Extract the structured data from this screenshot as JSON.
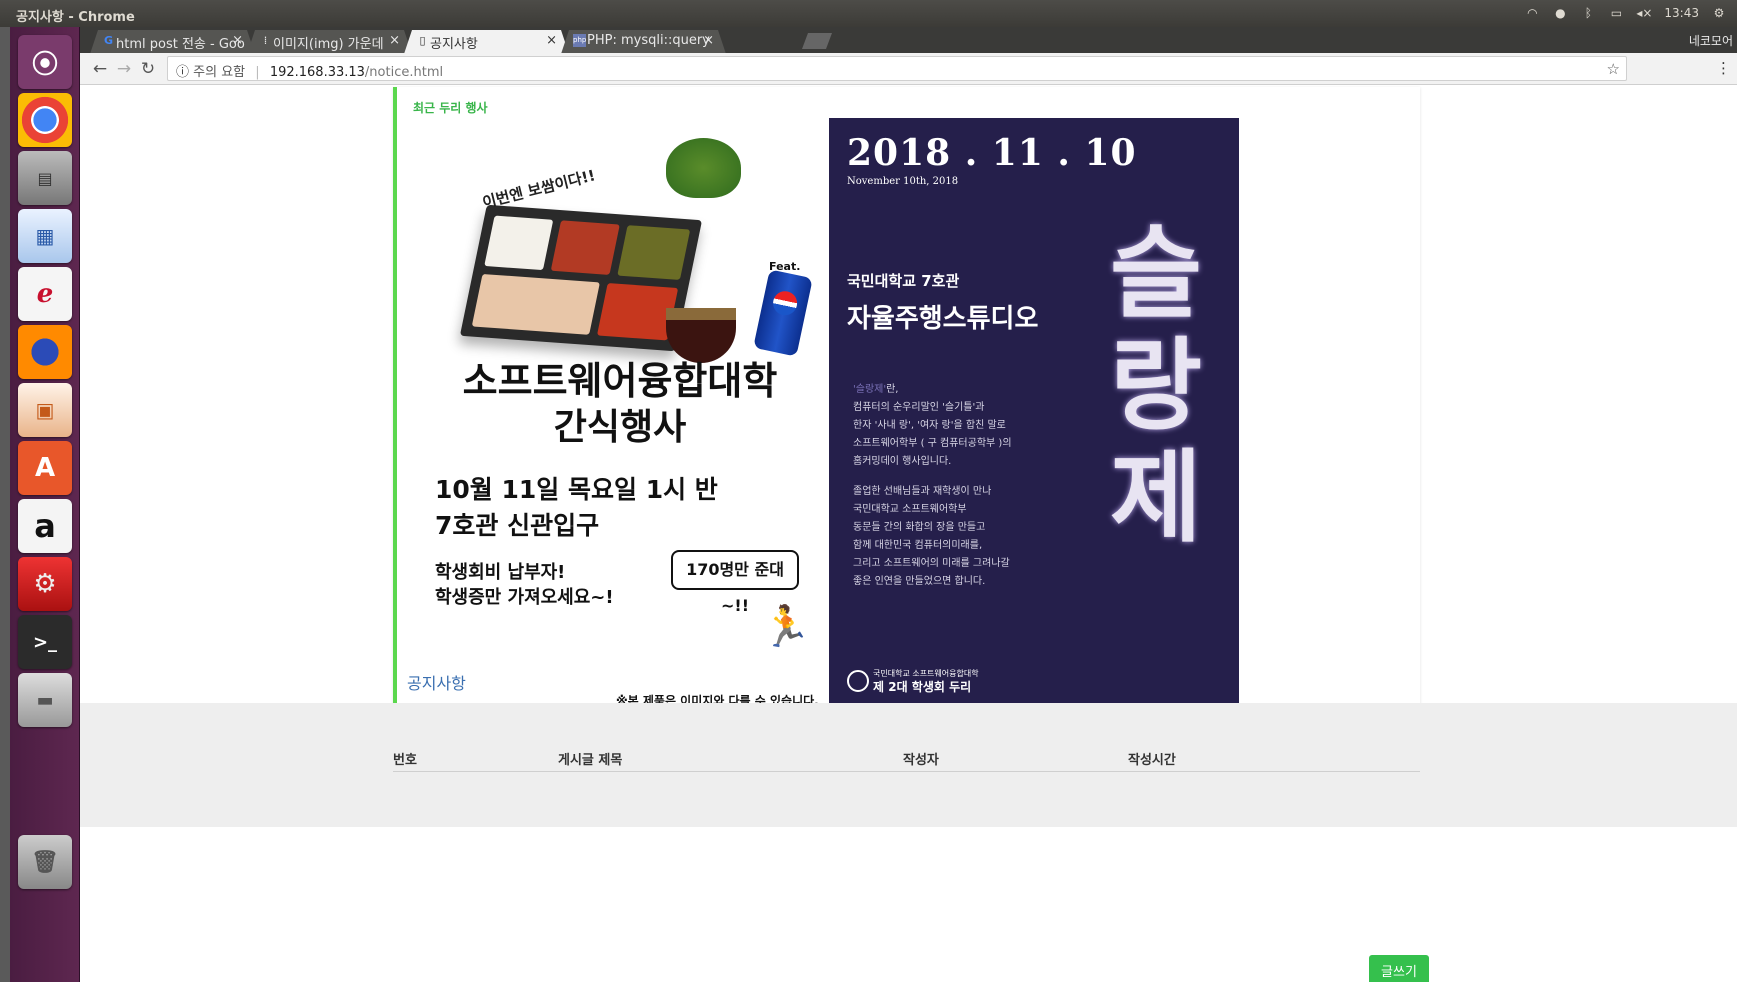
{
  "os": {
    "window_title": "공지사항 - Chrome",
    "clock": "13:43"
  },
  "browser": {
    "tabs": [
      {
        "label": "html post 전송 - Goo",
        "icon": "google-icon"
      },
      {
        "label": "이미지(img) 가운데",
        "icon": "image-tab-icon"
      },
      {
        "label": "공지사항",
        "icon": "page-icon"
      },
      {
        "label": "PHP: mysqli::query",
        "icon": "php-icon"
      }
    ],
    "profile": "네코모어",
    "address": {
      "warning": "주의 요함",
      "host": "192.168.33.13",
      "path": "/notice.html"
    }
  },
  "page": {
    "banner_title": "최근 두리 행사",
    "poster_left": {
      "subtitle": "이번엔 보쌈이다!!",
      "feat": "Feat.",
      "heading_1": "소프트웨어융합대학",
      "heading_2": "간식행사",
      "date_1": "10월 11일 목요일 1시 반",
      "date_2": "7호관 신관입구",
      "note_1": "학생회비 납부자!",
      "note_2": "학생증만 가져오세요~!",
      "bubble": "170명만 준대~!!",
      "disclaimer": "※본 제품은 이미지와 다를 수 있습니다."
    },
    "poster_right": {
      "date": "2018 . 11 . 10",
      "date_en": "November 10th, 2018",
      "venue": "국민대학교 7호관",
      "studio": "자율주행스튜디오",
      "description_lines": [
        {
          "highlight": "'슬랑제'",
          "text": "란,"
        },
        {
          "highlight": "",
          "text": "컴퓨터의 순우리말인 '슬기틀'과"
        },
        {
          "highlight": "",
          "text": "한자 '사내 랑', '여자 랑'을 합친 말로"
        },
        {
          "highlight": "",
          "text": "소프트웨어학부 ( 구 컴퓨터공학부 )의"
        },
        {
          "highlight": "",
          "text": "홈커밍데이 행사입니다."
        },
        {
          "highlight": "",
          "text": "졸업한 선배님들과 재학생이 만나"
        },
        {
          "highlight": "",
          "text": "국민대학교 소프트웨어학부"
        },
        {
          "highlight": "",
          "text": "동문들 간의 화합의 장을 만들고"
        },
        {
          "highlight": "",
          "text": "함께 대한민국 컴퓨터의미래를,"
        },
        {
          "highlight": "",
          "text": "그리고 소프트웨어의 미래를 그려나갈"
        },
        {
          "highlight": "",
          "text": "좋은 인연을 만들었으면 합니다."
        }
      ],
      "festival": [
        "슬",
        "랑",
        "제"
      ],
      "council_small": "국민대학교 소프트웨어융합대학",
      "council_name": "제 2대 학생회 두리"
    },
    "notice": {
      "title": "공지사항",
      "columns": [
        "번호",
        "게시글 제목",
        "작성자",
        "작성시간"
      ],
      "write_button": "글쓰기"
    }
  },
  "colors": {
    "accent_green": "#5bd74d",
    "button_green": "#35c04d",
    "poster_navy": "#251f4b",
    "launcher_purple": "#5e2750"
  }
}
